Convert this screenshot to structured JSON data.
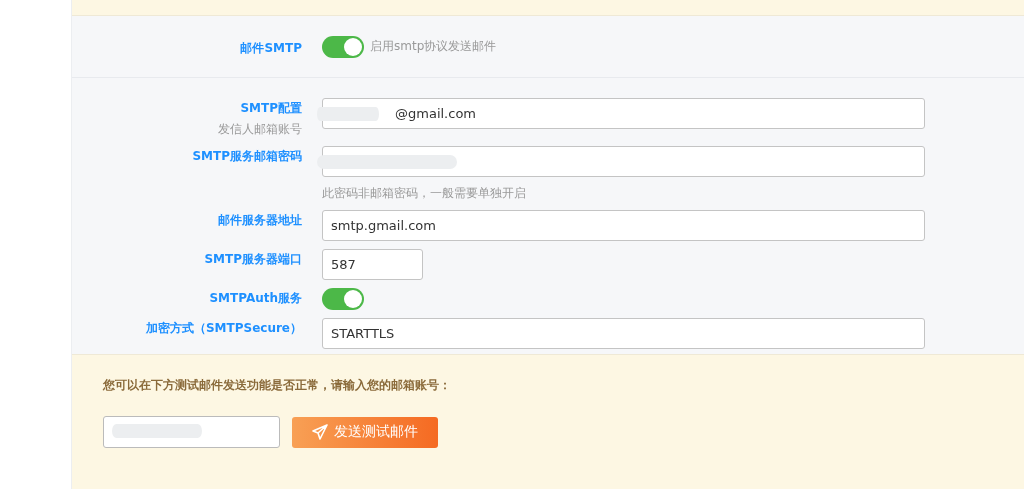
{
  "smtp_switch": {
    "label": "邮件SMTP",
    "on": true,
    "description": "启用smtp协议发送邮件"
  },
  "settings": [
    {
      "kind": "text",
      "label": "SMTP配置",
      "sublabel": "发信人邮箱账号",
      "value": "@gmail.com",
      "redacted": true
    },
    {
      "kind": "text",
      "label": "SMTP服务邮箱密码",
      "hint": "此密码非邮箱密码，一般需要单独开启",
      "redacted": true
    },
    {
      "kind": "text",
      "label": "邮件服务器地址",
      "value": "smtp.gmail.com"
    },
    {
      "kind": "short_text",
      "label": "SMTP服务器端口",
      "value": "587"
    },
    {
      "kind": "toggle",
      "label": "SMTPAuth服务",
      "on": true
    },
    {
      "kind": "text",
      "label": "加密方式（SMTPSecure）",
      "value": "STARTTLS"
    }
  ],
  "test": {
    "prompt": "您可以在下方测试邮件发送功能是否正常，请输入您的邮箱账号：",
    "redacted": true,
    "button": "发送测试邮件"
  }
}
